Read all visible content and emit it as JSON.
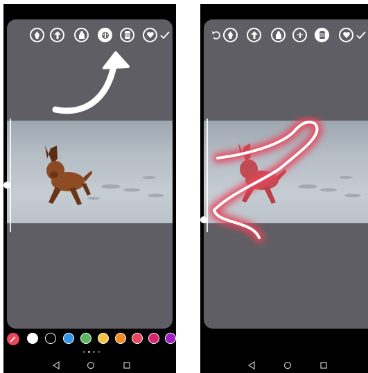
{
  "left_screen": {
    "toolbar": {
      "tools": [
        {
          "icon": "pen-icon",
          "state": "normal"
        },
        {
          "icon": "arrow-pen-icon",
          "state": "normal"
        },
        {
          "icon": "marker-icon",
          "state": "normal"
        },
        {
          "icon": "glow-pen-icon",
          "state": "selected"
        },
        {
          "icon": "chalk-icon",
          "state": "normal"
        },
        {
          "icon": "heart-pen-icon",
          "state": "normal"
        }
      ],
      "confirm_icon": "checkmark-icon"
    },
    "annotation_icon": "curved-arrow-icon",
    "palette": {
      "picker_icon": "eyedropper-icon",
      "colors": [
        "#ffffff",
        "#000000",
        "#3396e5",
        "#5cb85c",
        "#f5c242",
        "#f28c28",
        "#e9455b",
        "#d6246e",
        "#a11ec4"
      ]
    },
    "page_indicator": {
      "count": 4,
      "active": 1
    }
  },
  "right_screen": {
    "toolbar": {
      "undo_icon": "undo-icon",
      "tools": [
        {
          "icon": "pen-icon",
          "state": "normal"
        },
        {
          "icon": "arrow-pen-icon",
          "state": "normal"
        },
        {
          "icon": "marker-icon",
          "state": "normal"
        },
        {
          "icon": "glow-pen-icon",
          "state": "normal"
        },
        {
          "icon": "chalk-icon",
          "state": "selected"
        },
        {
          "icon": "heart-pen-icon",
          "state": "normal"
        }
      ],
      "confirm_icon": "checkmark-icon"
    },
    "stroke_color": "#e9455b"
  },
  "colors": {
    "canvas": "#5f5e64",
    "glow": "#e9455b",
    "phone_frame": "#000000"
  }
}
